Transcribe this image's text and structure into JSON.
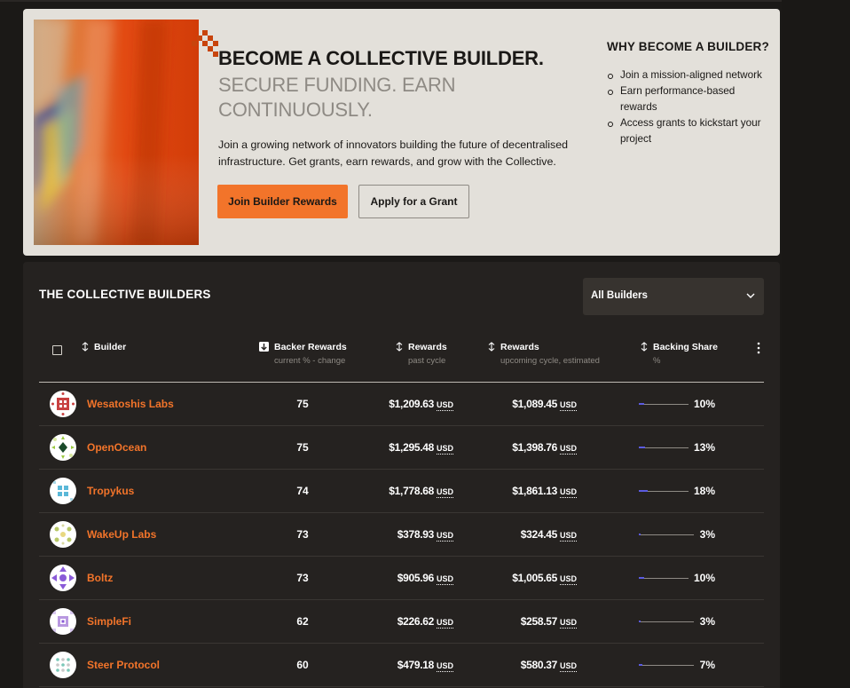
{
  "hero": {
    "title": "BECOME A COLLECTIVE BUILDER.",
    "subtitle": "SECURE FUNDING. EARN CONTINUOUSLY.",
    "description": "Join a growing network of innovators building the future of decentralised infrastructure. Get grants, earn rewards, and grow with the Collective.",
    "primary_button": "Join Builder Rewards",
    "secondary_button": "Apply for a Grant",
    "why_title": "WHY BECOME A BUILDER?",
    "why_items": [
      "Join a mission-aligned network",
      "Earn performance-based rewards",
      "Access grants to kickstart your project"
    ],
    "accent_color": "#f2742a"
  },
  "builders": {
    "title": "THE COLLECTIVE BUILDERS",
    "filter": {
      "selected": "All Builders"
    },
    "columns": {
      "builder": {
        "label": "Builder"
      },
      "backer": {
        "label": "Backer Rewards",
        "sub": "current % - change"
      },
      "rewards_past": {
        "label": "Rewards",
        "sub": "past cycle"
      },
      "rewards_upcoming": {
        "label": "Rewards",
        "sub": "upcoming cycle, estimated"
      },
      "share": {
        "label": "Backing Share",
        "sub": "%"
      }
    },
    "currency": "USD",
    "rows": [
      {
        "name": "Wesatoshis Labs",
        "backer": "75",
        "past": "$1,209.63",
        "upcoming": "$1,089.45",
        "share": "10%",
        "share_pct": 10,
        "bar_width": 56
      },
      {
        "name": "OpenOcean",
        "backer": "75",
        "past": "$1,295.48",
        "upcoming": "$1,398.76",
        "share": "13%",
        "share_pct": 13,
        "bar_width": 56
      },
      {
        "name": "Tropykus",
        "backer": "74",
        "past": "$1,778.68",
        "upcoming": "$1,861.13",
        "share": "18%",
        "share_pct": 18,
        "bar_width": 56
      },
      {
        "name": "WakeUp Labs",
        "backer": "73",
        "past": "$378.93",
        "upcoming": "$324.45",
        "share": "3%",
        "share_pct": 3,
        "bar_width": 62
      },
      {
        "name": "Boltz",
        "backer": "73",
        "past": "$905.96",
        "upcoming": "$1,005.65",
        "share": "10%",
        "share_pct": 10,
        "bar_width": 56
      },
      {
        "name": "SimpleFi",
        "backer": "62",
        "past": "$226.62",
        "upcoming": "$258.57",
        "share": "3%",
        "share_pct": 3,
        "bar_width": 62
      },
      {
        "name": "Steer Protocol",
        "backer": "60",
        "past": "$479.18",
        "upcoming": "$580.37",
        "share": "7%",
        "share_pct": 7,
        "bar_width": 62
      }
    ]
  }
}
